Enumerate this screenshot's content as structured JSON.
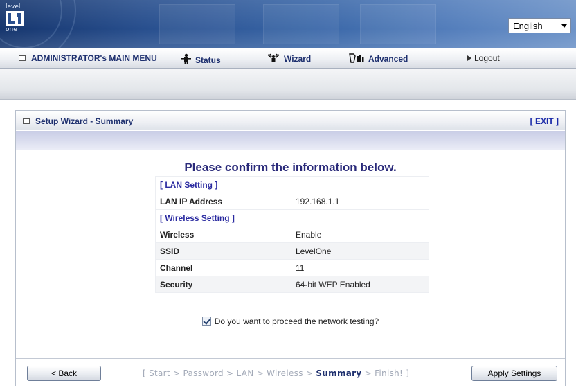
{
  "header": {
    "logo_top": "level",
    "logo_bottom": "one",
    "language": {
      "selected": "English"
    }
  },
  "nav": {
    "main_menu": "ADMINISTRATOR's MAIN MENU",
    "items": [
      {
        "label": "Status",
        "icon": "status-icon"
      },
      {
        "label": "Wizard",
        "icon": "wizard-icon"
      },
      {
        "label": "Advanced",
        "icon": "advanced-icon"
      },
      {
        "label": "Logout",
        "icon": "arrow-right-icon"
      }
    ]
  },
  "panel": {
    "title": "Setup Wizard - Summary",
    "exit": "[ EXIT ]"
  },
  "summary": {
    "heading": "Please confirm the information below.",
    "lan_section": "[ LAN Setting ]",
    "lan_ip_label": "LAN IP Address",
    "lan_ip_value": "192.168.1.1",
    "wireless_section": "[ Wireless Setting ]",
    "rows": [
      {
        "label": "Wireless",
        "value": "Enable"
      },
      {
        "label": "SSID",
        "value": "LevelOne"
      },
      {
        "label": "Channel",
        "value": "11"
      },
      {
        "label": "Security",
        "value": "64-bit WEP Enabled"
      }
    ],
    "test_checked": true,
    "test_label": "Do you want to proceed the network testing?"
  },
  "footer": {
    "back_label": "< Back",
    "apply_label": "Apply Settings",
    "steps_before": "[ Start > Password > LAN > Wireless > ",
    "steps_current": "Summary",
    "steps_after": " > Finish! ]"
  },
  "colors": {
    "nav_text": "#1d2f6e",
    "section_text": "#2a2aa0",
    "heading_text": "#2a2a7a"
  }
}
